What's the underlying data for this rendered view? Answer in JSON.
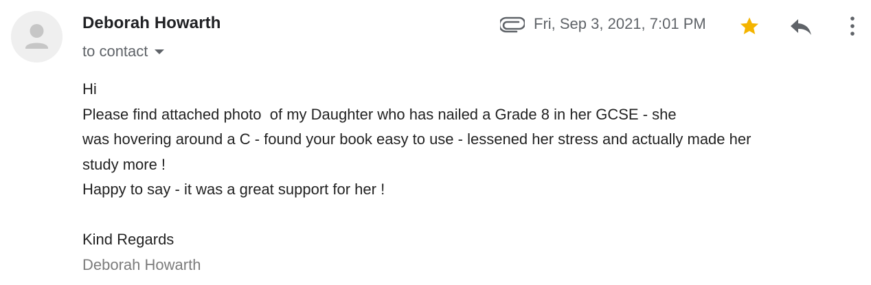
{
  "sender": {
    "name": "Deborah Howarth",
    "recipient": "to contact"
  },
  "meta": {
    "date": "Fri, Sep 3, 2021, 7:01 PM",
    "starred": true,
    "has_attachment": true
  },
  "icons": {
    "avatar": "person-avatar-icon",
    "attachment": "paperclip-icon",
    "dropdown": "caret-down-icon",
    "star": "star-icon",
    "reply": "reply-icon",
    "more": "more-vertical-icon"
  },
  "colors": {
    "star": "#f4b400",
    "muted_text": "#5f6368",
    "signature": "#7b7b7b",
    "body_text": "#222222"
  },
  "body": {
    "lines": [
      "Hi",
      "Please find attached photo  of my Daughter who has nailed a Grade 8 in her GCSE - she",
      "was hovering around a C - found your book easy to use - lessened her stress and actually made her",
      "study more !",
      "Happy to say - it was a great support for her !",
      "",
      "Kind Regards"
    ],
    "signature": "Deborah Howarth"
  }
}
